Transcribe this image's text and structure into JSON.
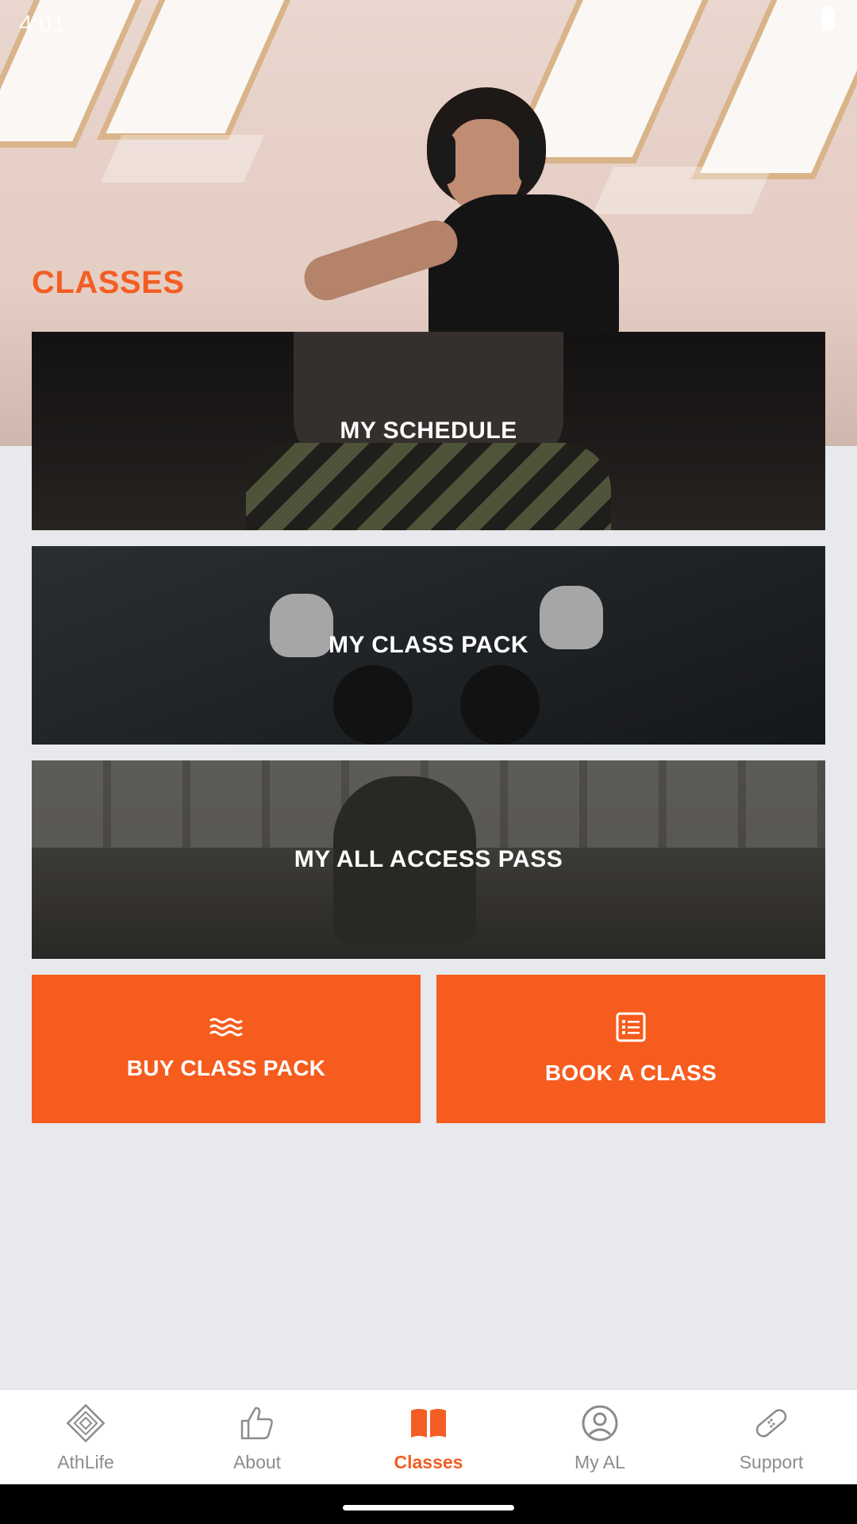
{
  "status_bar": {
    "time": "4:01"
  },
  "page": {
    "title": "CLASSES"
  },
  "cards": {
    "schedule": "MY SCHEDULE",
    "class_pack": "MY CLASS PACK",
    "all_access": "MY ALL ACCESS PASS"
  },
  "actions": {
    "buy": {
      "label": "BUY CLASS PACK",
      "icon": "waves-icon"
    },
    "book": {
      "label": "BOOK A CLASS",
      "icon": "list-icon"
    }
  },
  "nav": {
    "items": [
      {
        "label": "AthLife",
        "icon": "athlife-logo-icon"
      },
      {
        "label": "About",
        "icon": "thumbs-up-icon"
      },
      {
        "label": "Classes",
        "icon": "book-icon",
        "active": true
      },
      {
        "label": "My AL",
        "icon": "account-icon"
      },
      {
        "label": "Support",
        "icon": "bandage-icon"
      }
    ]
  },
  "colors": {
    "accent": "#f45d23",
    "button": "#f65c1e",
    "background": "#e8e9ec"
  }
}
